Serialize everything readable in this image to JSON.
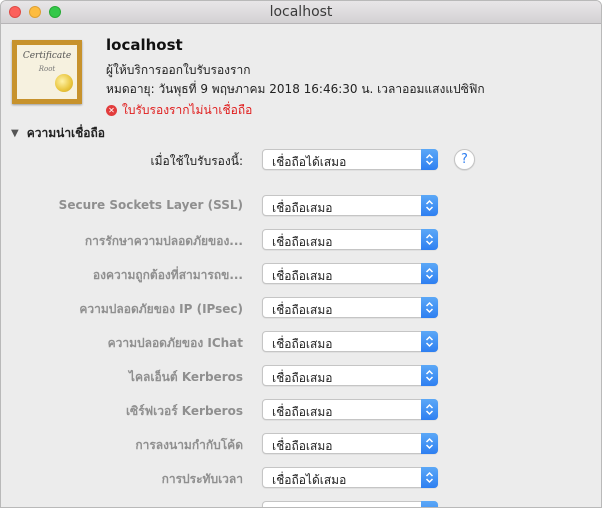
{
  "window": {
    "title": "localhost"
  },
  "certificate": {
    "icon_word": "Certificate",
    "icon_sub": "Root",
    "name": "localhost",
    "issuer_label": "ผู้ให้บริการออกใบรับรองราก",
    "expires_text": "หมดอายุ: วันพุธที่ 9 พฤษภาคม 2018 16:46:30 น. เวลาออมแสงแปซิฟิก",
    "status_text": "ใบรับรองรากไม่น่าเชื่อถือ",
    "status_icon": "error-x-icon",
    "status_color": "#e01c1c"
  },
  "trust": {
    "section_label": "ความน่าเชื่อถือ",
    "main_label": "เมื่อใช้ใบรับรองนี้:",
    "main_value": "เชื่อถือได้เสมอ",
    "help_label": "?",
    "rows": [
      {
        "label": "Secure Sockets Layer (SSL)",
        "value": "เชื่อถือเสมอ"
      },
      {
        "label": "การรักษาความปลอดภัยของ...",
        "value": "เชื่อถือเสมอ"
      },
      {
        "label": "องความถูกต้องที่สามารถข...",
        "value": "เชื่อถือเสมอ"
      },
      {
        "label": "ความปลอดภัยของ IP (IPsec)",
        "value": "เชื่อถือเสมอ"
      },
      {
        "label": "ความปลอดภัยของ IChat",
        "value": "เชื่อถือเสมอ"
      },
      {
        "label": "ไคลเอ็นต์ Kerberos",
        "value": "เชื่อถือเสมอ"
      },
      {
        "label": "เซิร์ฟเวอร์ Kerberos",
        "value": "เชื่อถือเสมอ"
      },
      {
        "label": "การลงนามกำกับโค้ด",
        "value": "เชื่อถือเสมอ"
      },
      {
        "label": "การประทับเวลา",
        "value": "เชื่อถือได้เสมอ"
      }
    ]
  },
  "colors": {
    "accent": "#2e7ff1",
    "background": "#ececec"
  }
}
